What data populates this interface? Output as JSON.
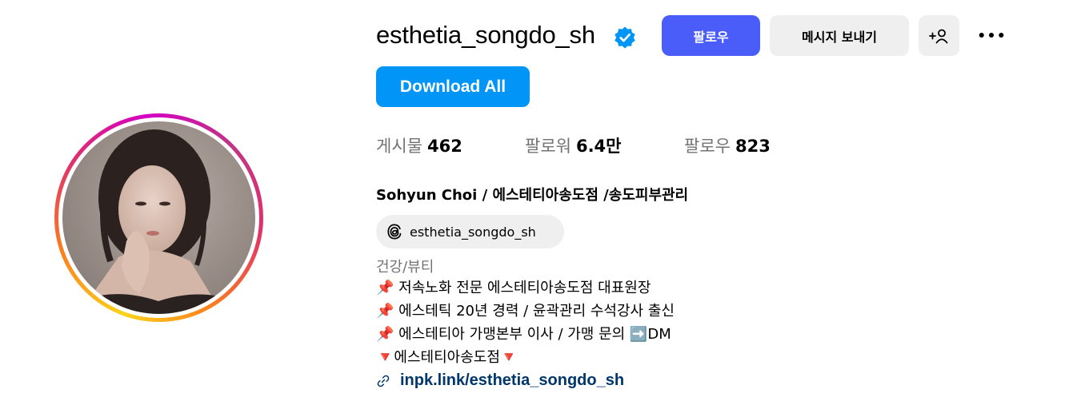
{
  "profile": {
    "username": "esthetia_songdo_sh",
    "verified_icon": "verified-badge-icon",
    "full_name": "Sohyun Choi / 에스테티아송도점 /송도피부관리",
    "category": "건강/뷰티",
    "threads_handle": "esthetia_songdo_sh",
    "link": "inpk.link/esthetia_songdo_sh"
  },
  "actions": {
    "follow_label": "팔로우",
    "message_label": "메시지 보내기",
    "add_user_icon": "add-person-icon",
    "more_icon": "more-horizontal-icon",
    "download_all_label": "Download All"
  },
  "stats": [
    {
      "label": "게시물",
      "value": "462"
    },
    {
      "label": "팔로워",
      "value": "6.4만"
    },
    {
      "label": "팔로우",
      "value": "823"
    }
  ],
  "bio": {
    "lines": [
      "📌 저속노화 전문 에스테티아송도점 대표원장",
      "📌 에스테틱 20년 경력 / 윤곽관리 수석강사 출신",
      "📌 에스테티아 가맹본부 이사 / 가맹 문의 ➡️DM",
      "🔻에스테티아송도점🔻"
    ]
  },
  "colors": {
    "follow_button": "#4a5df9",
    "download_button": "#0095f6",
    "secondary_button": "#efefef",
    "verified": "#0095f6",
    "link": "#00376b",
    "muted_text": "#737373"
  }
}
